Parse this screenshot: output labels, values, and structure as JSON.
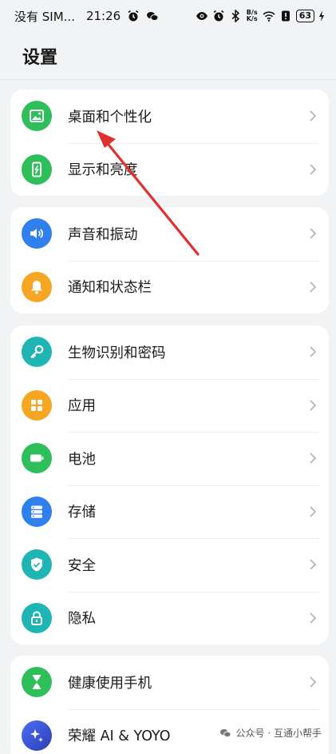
{
  "status_bar": {
    "carrier": "没有 SIM...",
    "time": "21:26",
    "battery": "63",
    "icons": [
      "alarm-icon",
      "wechat-icon",
      "eye-icon",
      "alarm-icon",
      "bluetooth-icon",
      "network-speed-icon",
      "wifi-icon",
      "notification-icon",
      "battery-icon"
    ]
  },
  "page": {
    "title": "设置"
  },
  "groups": [
    {
      "items": [
        {
          "label": "桌面和个性化",
          "icon": "image-icon",
          "color": "#2fbf5a"
        },
        {
          "label": "显示和亮度",
          "icon": "phone-brightness-icon",
          "color": "#2fbf5a"
        }
      ]
    },
    {
      "items": [
        {
          "label": "声音和振动",
          "icon": "speaker-icon",
          "color": "#2f80ed"
        },
        {
          "label": "通知和状态栏",
          "icon": "bell-icon",
          "color": "#f5a623"
        }
      ]
    },
    {
      "items": [
        {
          "label": "生物识别和密码",
          "icon": "key-icon",
          "color": "#1fb5b5"
        },
        {
          "label": "应用",
          "icon": "apps-grid-icon",
          "color": "#f5a623"
        },
        {
          "label": "电池",
          "icon": "battery-icon",
          "color": "#2fbf5a"
        },
        {
          "label": "存储",
          "icon": "storage-icon",
          "color": "#2f80ed"
        },
        {
          "label": "安全",
          "icon": "shield-icon",
          "color": "#1fb5b5"
        },
        {
          "label": "隐私",
          "icon": "privacy-lock-icon",
          "color": "#1fb5b5"
        }
      ]
    },
    {
      "items": [
        {
          "label": "健康使用手机",
          "icon": "hourglass-icon",
          "color": "#2fbf5a"
        },
        {
          "label": "荣耀 AI & YOYO",
          "icon": "sparkle-icon",
          "color": "#3b5bdb"
        }
      ]
    }
  ],
  "annotation": {
    "color": "#e03131"
  },
  "watermark": {
    "text": "公众号 · 互通小帮手"
  }
}
